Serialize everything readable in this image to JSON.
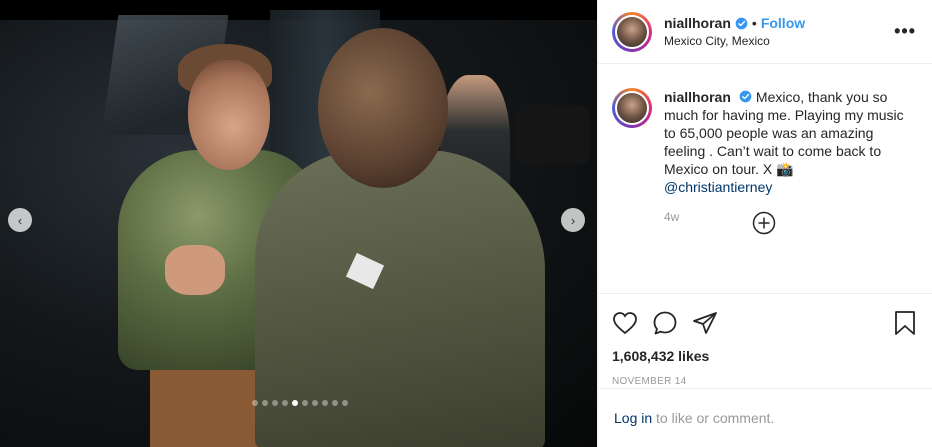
{
  "post": {
    "username": "niallhoran",
    "follow_label": "Follow",
    "bullet": "•",
    "location": "Mexico City, Mexico",
    "more_label": "•••",
    "caption_text": "Mexico, thank you so much for having me. Playing my music to 65,000 people was an amazing feeling . Can’t wait to come back to Mexico on tour. X 📸",
    "caption_mention": "@christiantierney",
    "time_ago": "4w",
    "likes": "1,608,432 likes",
    "date": "NOVEMBER 14",
    "login_link": "Log in",
    "login_rest": " to like or comment."
  },
  "carousel": {
    "prev_label": "‹",
    "next_label": "›",
    "dot_count": 10,
    "active_dot": 4
  },
  "colors": {
    "accent": "#3897f0",
    "verified": "#3897f0",
    "link": "#003569"
  }
}
